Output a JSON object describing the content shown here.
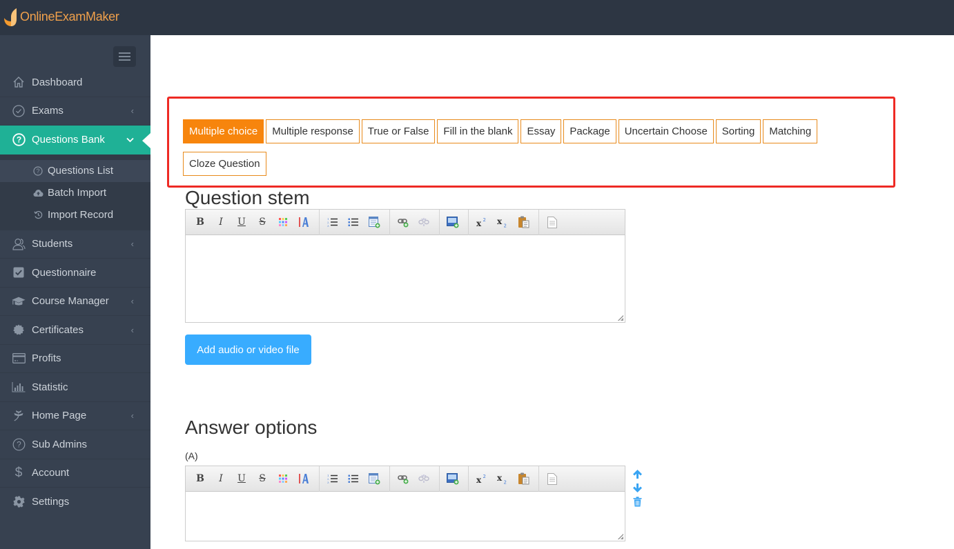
{
  "app": {
    "brand": "OnlineExamMaker",
    "accent": "#1fb196",
    "topbar_color": "#2d3643",
    "sidebar_color": "#374150"
  },
  "sidebar": {
    "items": [
      {
        "label": "Dashboard",
        "icon": "home-icon",
        "has_chevron": false
      },
      {
        "label": "Exams",
        "icon": "check-circle-icon",
        "has_chevron": true
      },
      {
        "label": "Questions Bank",
        "icon": "question-circle-icon",
        "has_chevron": true,
        "active": true,
        "children": [
          {
            "label": "Questions List",
            "icon": "question-circle-icon",
            "current": true
          },
          {
            "label": "Batch Import",
            "icon": "cloud-upload-icon"
          },
          {
            "label": "Import Record",
            "icon": "history-icon"
          }
        ]
      },
      {
        "label": "Students",
        "icon": "users-icon",
        "has_chevron": true
      },
      {
        "label": "Questionnaire",
        "icon": "checkbox-icon",
        "has_chevron": false
      },
      {
        "label": "Course Manager",
        "icon": "graduation-cap-icon",
        "has_chevron": true
      },
      {
        "label": "Certificates",
        "icon": "badge-icon",
        "has_chevron": true
      },
      {
        "label": "Profits",
        "icon": "credit-card-icon",
        "has_chevron": false
      },
      {
        "label": "Statistic",
        "icon": "bar-chart-icon",
        "has_chevron": false
      },
      {
        "label": "Home Page",
        "icon": "leaf-icon",
        "has_chevron": true
      },
      {
        "label": "Sub Admins",
        "icon": "question-circle-icon",
        "has_chevron": false
      },
      {
        "label": "Account",
        "icon": "dollar-icon",
        "has_chevron": false
      },
      {
        "label": "Settings",
        "icon": "gear-icon",
        "has_chevron": false
      }
    ]
  },
  "question_types": {
    "selected": "Multiple choice",
    "items": [
      "Multiple choice",
      "Multiple response",
      "True or False",
      "Fill in the blank",
      "Essay",
      "Package",
      "Uncertain Choose",
      "Sorting",
      "Matching",
      "Cloze Question"
    ],
    "highlight_color": "#ee2a24",
    "selected_color": "#f7850d"
  },
  "stem": {
    "heading": "Question stem",
    "content": "",
    "media_button": "Add audio or video file"
  },
  "editor_toolbar": {
    "groups": [
      [
        "bold",
        "italic",
        "underline",
        "strikethrough",
        "text-color",
        "background-color"
      ],
      [
        "ordered-list",
        "unordered-list",
        "insert-table"
      ],
      [
        "insert-link",
        "remove-link"
      ],
      [
        "insert-image"
      ],
      [
        "superscript",
        "subscript",
        "paste"
      ],
      [
        "source"
      ]
    ],
    "glyphs": {
      "bold": "B",
      "italic": "I",
      "underline": "U",
      "strikethrough": "S"
    }
  },
  "answers": {
    "heading": "Answer options",
    "options": [
      {
        "label": "(A)",
        "content": ""
      }
    ]
  }
}
